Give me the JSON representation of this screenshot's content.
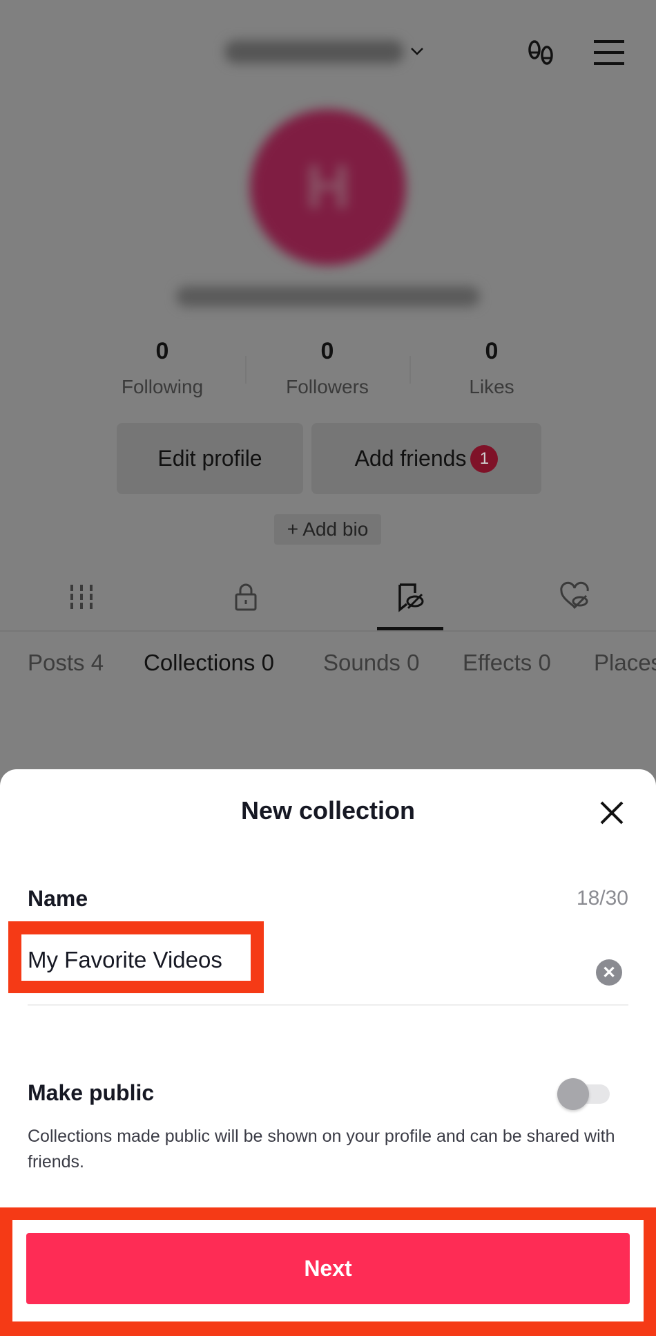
{
  "profile": {
    "avatar_initial": "H",
    "stats": [
      {
        "value": "0",
        "label": "Following"
      },
      {
        "value": "0",
        "label": "Followers"
      },
      {
        "value": "0",
        "label": "Likes"
      }
    ],
    "edit_profile": "Edit profile",
    "add_friends": "Add friends",
    "add_friends_badge": "1",
    "add_bio": "+ Add bio"
  },
  "tabs": {
    "icons": [
      "grid-icon",
      "lock-icon",
      "bookmark-hidden-icon",
      "heart-hidden-icon"
    ],
    "active_icon_index": 2,
    "sub_tabs": [
      "Posts 4",
      "Collections 0",
      "Sounds 0",
      "Effects 0",
      "Places"
    ],
    "active_sub_tab": "Collections 0"
  },
  "sheet": {
    "title": "New collection",
    "name_label": "Name",
    "counter": "18/30",
    "name_value": "My Favorite Videos",
    "make_public_label": "Make public",
    "make_public_on": false,
    "description": "Collections made public will be shown on your profile and can be shared with friends.",
    "next_label": "Next"
  },
  "colors": {
    "accent": "#fe2c55",
    "highlight": "#f53a16",
    "overlay": "#808080"
  }
}
